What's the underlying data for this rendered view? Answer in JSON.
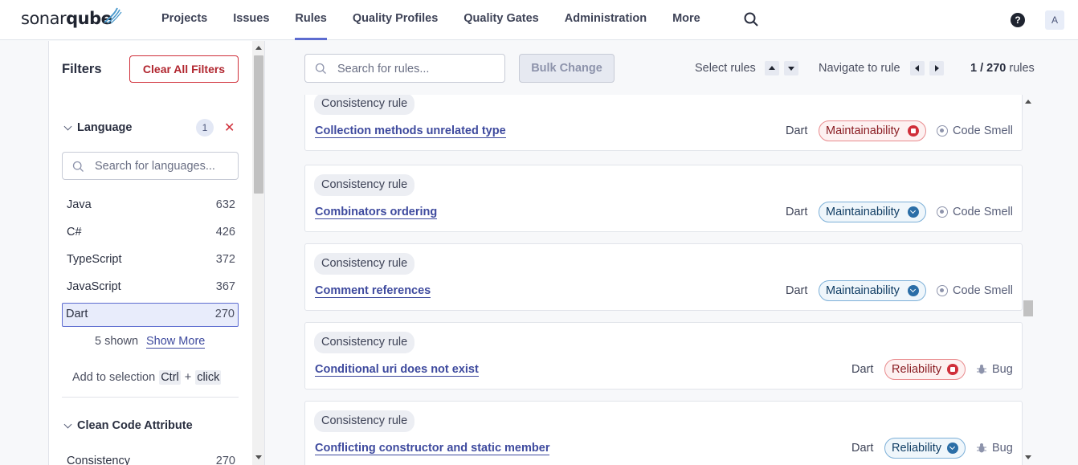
{
  "app": {
    "logo_light": "sonar",
    "logo_bold": "qube"
  },
  "nav": {
    "items": [
      "Projects",
      "Issues",
      "Rules",
      "Quality Profiles",
      "Quality Gates",
      "Administration",
      "More"
    ],
    "active": "Rules",
    "avatar": "A",
    "help": "?"
  },
  "filters": {
    "title": "Filters",
    "clear_label": "Clear All Filters",
    "language": {
      "title": "Language",
      "count": "1",
      "search_placeholder": "Search for languages...",
      "items": [
        {
          "name": "Java",
          "count": "632"
        },
        {
          "name": "C#",
          "count": "426"
        },
        {
          "name": "TypeScript",
          "count": "372"
        },
        {
          "name": "JavaScript",
          "count": "367"
        },
        {
          "name": "Dart",
          "count": "270"
        }
      ],
      "selected": "Dart",
      "shown_text": "5 shown",
      "show_more": "Show More",
      "add_selection": "Add to selection",
      "key_ctrl": "Ctrl",
      "plus": "+",
      "key_click": "click"
    },
    "clean_code": {
      "title": "Clean Code Attribute",
      "items": [
        {
          "name": "Consistency",
          "count": "270"
        }
      ]
    }
  },
  "toolbar": {
    "search_placeholder": "Search for rules...",
    "bulk_change": "Bulk Change",
    "select_rules": "Select rules",
    "navigate_to_rule": "Navigate to rule",
    "paging_current": "1 / 270",
    "paging_suffix": "rules"
  },
  "rules": [
    {
      "attribute": "Consistency rule",
      "name": "Collection methods unrelated type",
      "language": "Dart",
      "impact": "Maintainability",
      "severity": "high",
      "type": "Code Smell"
    },
    {
      "attribute": "Consistency rule",
      "name": "Combinators ordering",
      "language": "Dart",
      "impact": "Maintainability",
      "severity": "low",
      "type": "Code Smell"
    },
    {
      "attribute": "Consistency rule",
      "name": "Comment references",
      "language": "Dart",
      "impact": "Maintainability",
      "severity": "low",
      "type": "Code Smell"
    },
    {
      "attribute": "Consistency rule",
      "name": "Conditional uri does not exist",
      "language": "Dart",
      "impact": "Reliability",
      "severity": "high",
      "type": "Bug"
    },
    {
      "attribute": "Consistency rule",
      "name": "Conflicting constructor and static member",
      "language": "Dart",
      "impact": "Reliability",
      "severity": "low",
      "type": "Bug"
    }
  ],
  "colors": {
    "accent": "#5d6cd0",
    "link": "#3e4a9e",
    "danger": "#d02f3a",
    "info": "#2b6ea7"
  }
}
